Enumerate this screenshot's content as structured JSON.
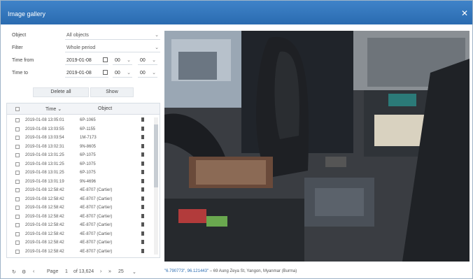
{
  "window": {
    "title": "Image gallery"
  },
  "filters": {
    "object_label": "Object",
    "object_value": "All objects",
    "filter_label": "Filter",
    "filter_value": "Whole period",
    "from_label": "Time from",
    "from_date": "2019-01-08",
    "from_hour": "00",
    "from_min": "00",
    "to_label": "Time to",
    "to_date": "2019-01-08",
    "to_hour": "00",
    "to_min": "00"
  },
  "actions": {
    "delete_all": "Delete all",
    "show": "Show"
  },
  "table": {
    "col_time": "Time",
    "col_object": "Object",
    "rows": [
      {
        "time": "2019-01-08 13:05:01",
        "object": "6P-1065"
      },
      {
        "time": "2019-01-08 13:03:55",
        "object": "6P-1155"
      },
      {
        "time": "2019-01-08 13:03:54",
        "object": "1M-7173"
      },
      {
        "time": "2019-01-08 13:02:31",
        "object": "9N-8605"
      },
      {
        "time": "2019-01-08 13:01:25",
        "object": "6P-1075"
      },
      {
        "time": "2019-01-08 13:01:25",
        "object": "6P-1075"
      },
      {
        "time": "2019-01-08 13:01:25",
        "object": "6P-1075"
      },
      {
        "time": "2019-01-08 13:01:19",
        "object": "9N-4696"
      },
      {
        "time": "2019-01-08 12:58:42",
        "object": "4E-8707 (Cartier)"
      },
      {
        "time": "2019-01-08 12:58:42",
        "object": "4E-8707 (Cartier)"
      },
      {
        "time": "2019-01-08 12:58:42",
        "object": "4E-8707 (Cartier)"
      },
      {
        "time": "2019-01-08 12:58:42",
        "object": "4E-8707 (Cartier)"
      },
      {
        "time": "2019-01-08 12:58:42",
        "object": "4E-8707 (Cartier)"
      },
      {
        "time": "2019-01-08 12:58:42",
        "object": "4E-8707 (Cartier)"
      },
      {
        "time": "2019-01-08 12:58:42",
        "object": "4E-8707 (Cartier)"
      },
      {
        "time": "2019-01-08 12:58:42",
        "object": "4E-8707 (Cartier)"
      }
    ]
  },
  "pager": {
    "page_label": "Page",
    "page_value": "1",
    "of_label": "of 13,624",
    "per_page": "25"
  },
  "caption": {
    "coords": "\"6.790773\", 96.121443\"",
    "address": "– 69 Aung Zeya St, Yangon, Myanmar (Burma)"
  },
  "image": {
    "description_icon": "photo"
  }
}
